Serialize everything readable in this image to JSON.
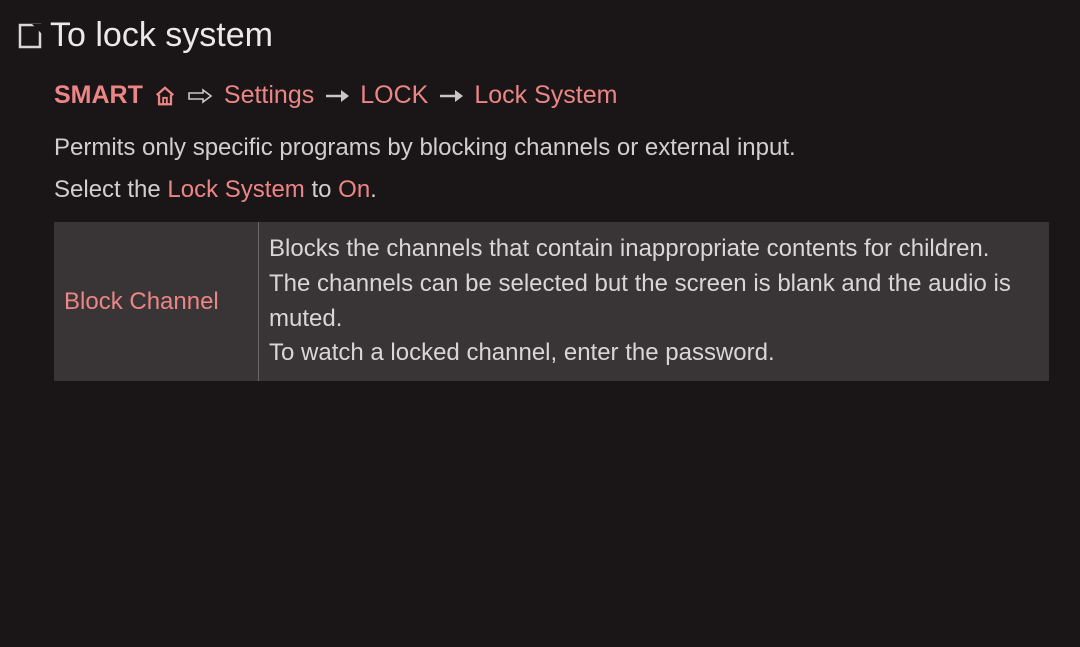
{
  "title": "To lock system",
  "breadcrumb": {
    "smart": "SMART",
    "settings": "Settings",
    "lock": "LOCK",
    "lock_system": "Lock System"
  },
  "description": "Permits only specific programs by blocking channels or external input.",
  "instruction": {
    "prefix": "Select the ",
    "highlight1": "Lock System",
    "mid": " to ",
    "highlight2": "On",
    "suffix": "."
  },
  "table": {
    "label": "Block Channel",
    "desc_line1": "Blocks the channels that contain inappropriate contents for children. The channels can be selected but the screen is blank and the audio is muted.",
    "desc_line2": "To watch a locked channel, enter the password."
  },
  "colors": {
    "accent": "#ec8585",
    "bg": "#1a1617",
    "text": "#d8d6d7",
    "table_bg": "#393536"
  }
}
